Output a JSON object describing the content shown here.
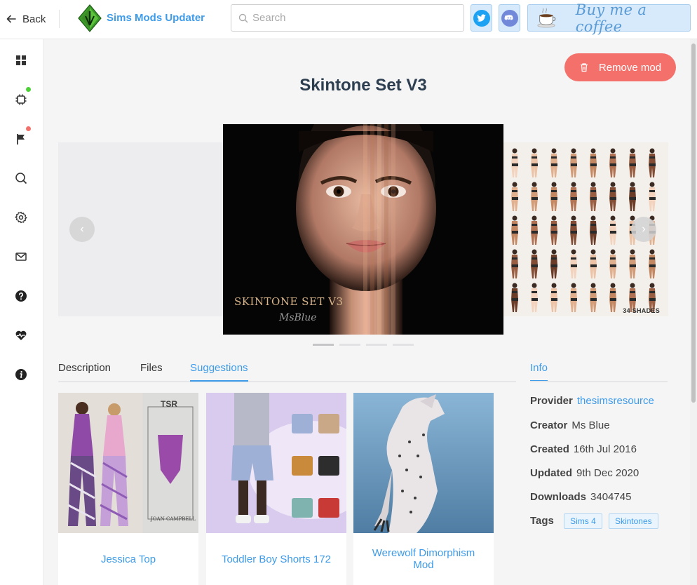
{
  "header": {
    "back_label": "Back",
    "app_title": "Sims Mods Updater",
    "search_placeholder": "Search",
    "search_value": "",
    "coffee_label": "Buy me a coffee"
  },
  "sidebar": {
    "items": [
      {
        "name": "dashboard"
      },
      {
        "name": "updates",
        "badge_color": "#4cd137"
      },
      {
        "name": "reports",
        "badge_color": "#f4706b"
      },
      {
        "name": "search"
      },
      {
        "name": "settings"
      },
      {
        "name": "messages"
      },
      {
        "name": "help"
      },
      {
        "name": "health"
      },
      {
        "name": "about"
      }
    ]
  },
  "mod": {
    "remove_label": "Remove mod",
    "title": "Skintone Set V3",
    "slide_caption": "SKINTONE SET V3",
    "slide_signature": "MsBlue",
    "side_slide_label": "34 SHADES",
    "carousel_slides": 4,
    "active_slide": 1
  },
  "tabs": {
    "items": [
      "Description",
      "Files",
      "Suggestions"
    ],
    "active": "Suggestions"
  },
  "suggestions": [
    {
      "title": "Jessica Top"
    },
    {
      "title": "Toddler Boy Shorts 172"
    },
    {
      "title": "Werewolf Dimorphism Mod"
    }
  ],
  "info": {
    "tab_label": "Info",
    "provider_label": "Provider",
    "provider_value": "thesimsresource",
    "creator_label": "Creator",
    "creator_value": "Ms Blue",
    "created_label": "Created",
    "created_value": "16th Jul 2016",
    "updated_label": "Updated",
    "updated_value": "9th Dec 2020",
    "downloads_label": "Downloads",
    "downloads_value": "3404745",
    "tags_label": "Tags",
    "tags": [
      "Sims 4",
      "Skintones"
    ]
  },
  "colors": {
    "accent": "#3d9be9",
    "danger": "#f4706b",
    "twitter": "#1da1f2",
    "discord": "#7289da"
  }
}
